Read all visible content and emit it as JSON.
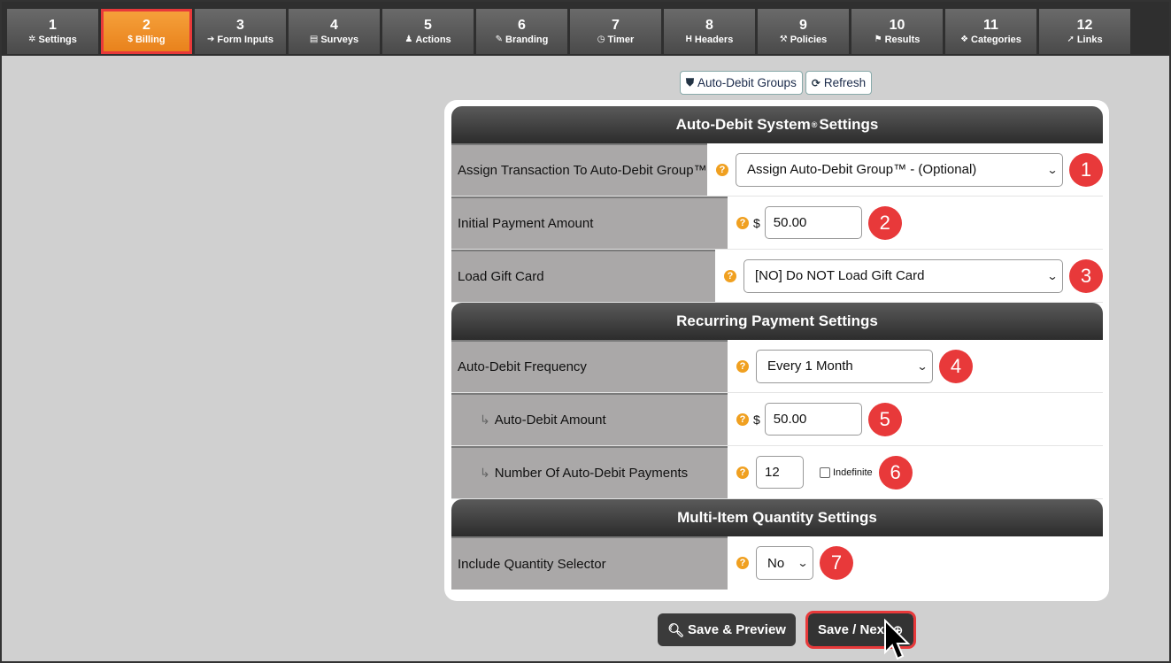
{
  "tabs": [
    {
      "num": "1",
      "label": "Settings",
      "icon": "gear-icon",
      "glyph": "✲"
    },
    {
      "num": "2",
      "label": "Billing",
      "icon": "dollar-icon",
      "glyph": "$"
    },
    {
      "num": "3",
      "label": "Form Inputs",
      "icon": "sign-in-icon",
      "glyph": "➔"
    },
    {
      "num": "4",
      "label": "Surveys",
      "icon": "list-icon",
      "glyph": "▤"
    },
    {
      "num": "5",
      "label": "Actions",
      "icon": "user-icon",
      "glyph": "♟"
    },
    {
      "num": "6",
      "label": "Branding",
      "icon": "brush-icon",
      "glyph": "✎"
    },
    {
      "num": "7",
      "label": "Timer",
      "icon": "clock-icon",
      "glyph": "◷"
    },
    {
      "num": "8",
      "label": "Headers",
      "icon": "header-icon",
      "glyph": "H"
    },
    {
      "num": "9",
      "label": "Policies",
      "icon": "gavel-icon",
      "glyph": "⚒"
    },
    {
      "num": "10",
      "label": "Results",
      "icon": "flag-icon",
      "glyph": "⚑"
    },
    {
      "num": "11",
      "label": "Categories",
      "icon": "cubes-icon",
      "glyph": "❖"
    },
    {
      "num": "12",
      "label": "Links",
      "icon": "pointer-icon",
      "glyph": "➚"
    }
  ],
  "active_tab": "2",
  "top_buttons": {
    "groups_label": "Auto-Debit Groups",
    "refresh_label": "Refresh"
  },
  "sections": {
    "autodebit_title": "Auto-Debit System",
    "autodebit_reg": "®",
    "autodebit_title_suffix": "Settings",
    "recurring_title": "Recurring Payment Settings",
    "multi_title": "Multi-Item Quantity Settings"
  },
  "rows": {
    "assign_group": {
      "label": "Assign Transaction To Auto-Debit Group™",
      "value": "Assign Auto-Debit Group™ - (Optional)",
      "badge": "1"
    },
    "initial_payment": {
      "label": "Initial Payment Amount",
      "currency": "$",
      "value": "50.00",
      "badge": "2"
    },
    "gift_card": {
      "label": "Load Gift Card",
      "value": "[NO] Do NOT Load Gift Card",
      "badge": "3"
    },
    "frequency": {
      "label": "Auto-Debit Frequency",
      "value": "Every 1 Month",
      "badge": "4"
    },
    "amount": {
      "label": "Auto-Debit Amount",
      "currency": "$",
      "value": "50.00",
      "badge": "5"
    },
    "num_payments": {
      "label": "Number Of Auto-Debit Payments",
      "value": "12",
      "checkbox_label": "Indefinite",
      "badge": "6"
    },
    "quantity": {
      "label": "Include Quantity Selector",
      "value": "No",
      "badge": "7"
    }
  },
  "bottom_buttons": {
    "preview_label": "Save & Preview",
    "next_label": "Save / Next"
  },
  "colors": {
    "active_tab": "#f08a28",
    "highlight": "#e8393a",
    "help": "#f0a020"
  }
}
